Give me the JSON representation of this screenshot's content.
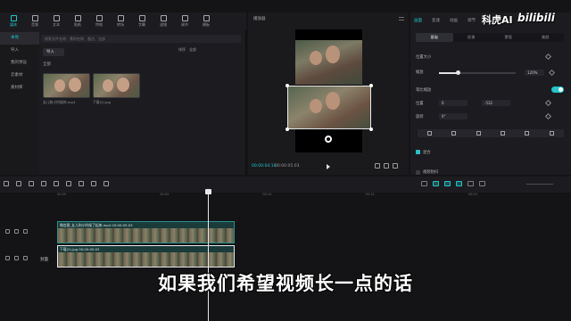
{
  "toolbar": {
    "items": [
      {
        "label": "媒体",
        "icon": "media-icon"
      },
      {
        "label": "音频",
        "icon": "audio-icon"
      },
      {
        "label": "文本",
        "icon": "text-icon"
      },
      {
        "label": "贴纸",
        "icon": "sticker-icon"
      },
      {
        "label": "特效",
        "icon": "effects-icon"
      },
      {
        "label": "转场",
        "icon": "transition-icon"
      },
      {
        "label": "字幕",
        "icon": "caption-icon"
      },
      {
        "label": "滤镜",
        "icon": "filter-icon"
      },
      {
        "label": "调节",
        "icon": "adjust-icon"
      },
      {
        "label": "模板",
        "icon": "template-icon"
      }
    ]
  },
  "sidenav": {
    "items": [
      {
        "label": "本地"
      },
      {
        "label": "导入"
      },
      {
        "label": "我的预设"
      },
      {
        "label": "云素材"
      },
      {
        "label": "素材库"
      }
    ]
  },
  "media": {
    "search_placeholder": "搜索文件名称、素材名称、备注、全部",
    "import_label": "导入",
    "sort_label": "排序",
    "filter_label": "全部",
    "all_label": "全部",
    "items": [
      {
        "caption": "女儿和小时候的.mp4"
      },
      {
        "caption": "下载(2).jpg"
      }
    ]
  },
  "player": {
    "title": "播放器",
    "time_current": "00:00:04:10",
    "time_total": "00:00:05:03"
  },
  "props": {
    "tabs": [
      "画面",
      "变速",
      "动画",
      "调节",
      "AI"
    ],
    "subtabs": [
      "基础",
      "抠像",
      "蒙版",
      "美颜"
    ],
    "section_title": "位置大小",
    "scale_label": "缩放",
    "scale_value": "120%",
    "uniform_label": "等比缩放",
    "position_label": "位置",
    "pos_x": "0",
    "pos_y": "-532",
    "rotate_label": "旋转",
    "rotate_value": "0°",
    "mix_label": "混合",
    "blend_label": "视频防抖"
  },
  "timeline": {
    "ruler": [
      "00:00",
      "",
      "00:05",
      "",
      "00:10",
      "",
      "00:15",
      "",
      "00:20",
      ""
    ],
    "clip1_caption": "微信图_女儿和小时候了起来.mp4  00:00:05:03",
    "clip2_caption": "下载(2).jpg  00:00:05:03",
    "cover_label": "封面"
  },
  "overlay": {
    "subtitle": "如果我们希望视频长一点的话",
    "watermark_text": "科虎AI",
    "watermark_logo": "bilibili"
  },
  "colors": {
    "accent": "#20c6c9",
    "clip_border": "#2a8f8a",
    "background": "#141416"
  }
}
